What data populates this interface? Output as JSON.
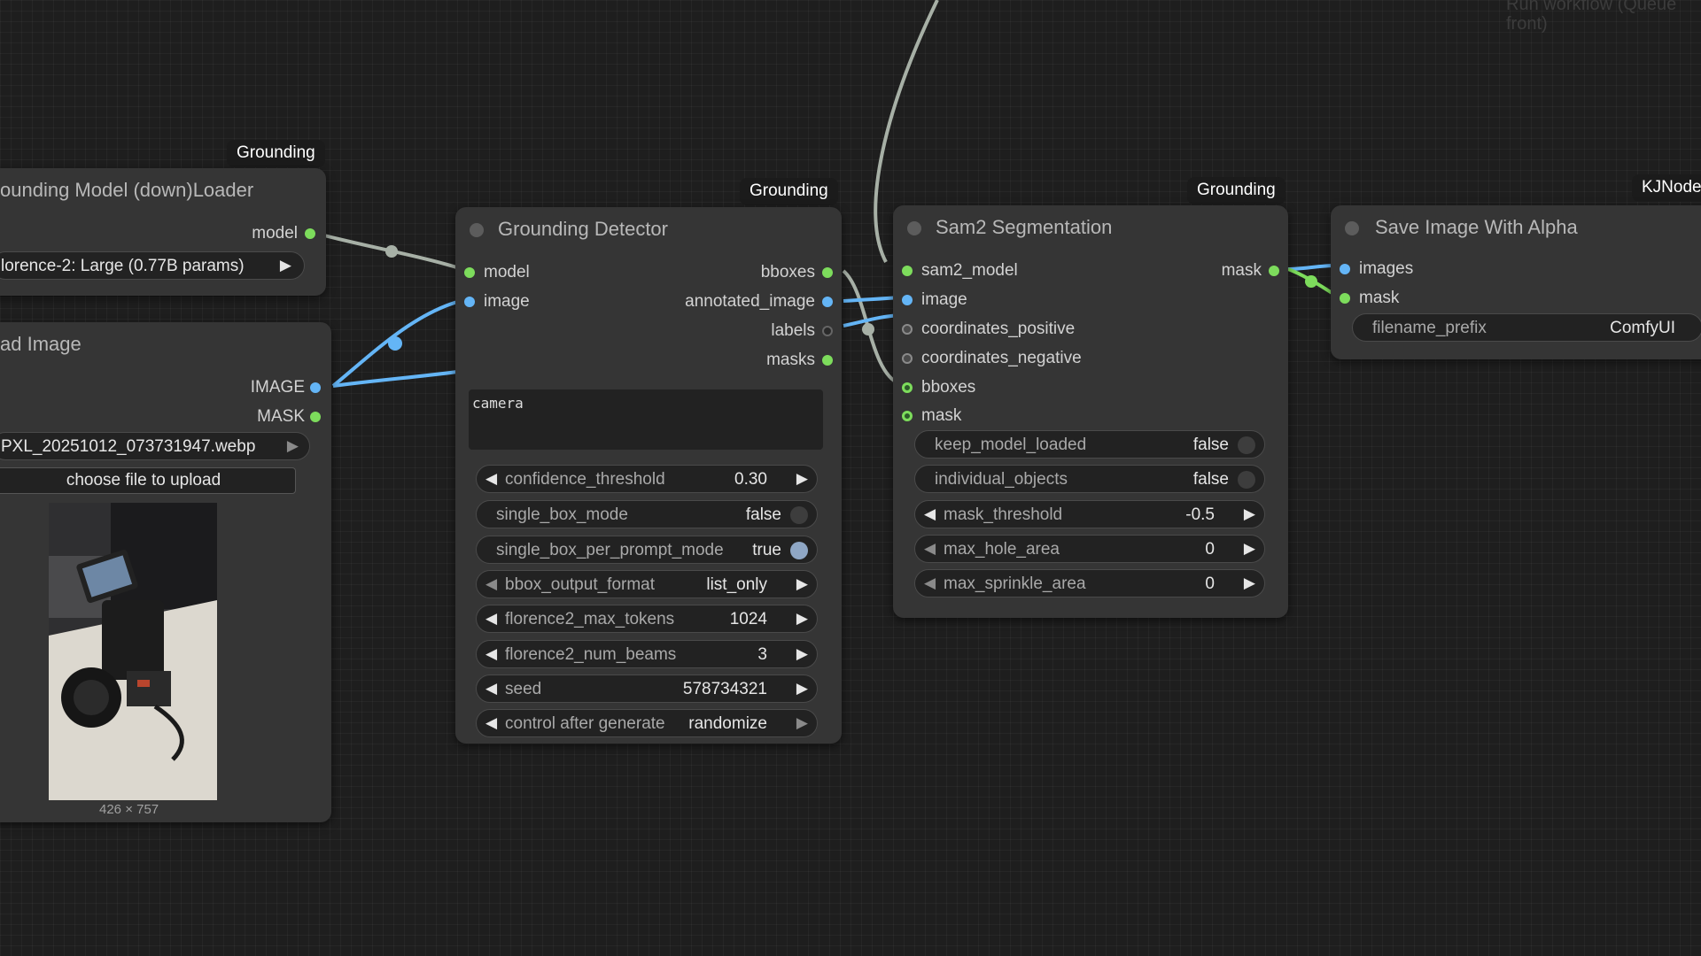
{
  "corner_hint": {
    "line1": "Run workflow (Queue",
    "line2": "front)"
  },
  "nodes": {
    "loader": {
      "badge": "Grounding",
      "title": "ounding Model (down)Loader",
      "output": "model",
      "model_value": "lorence-2: Large (0.77B params)"
    },
    "load_image": {
      "title": "ad Image",
      "outputs": [
        "IMAGE",
        "MASK"
      ],
      "file_value": "PXL_20251012_073731947.webp",
      "upload_label": "choose file to upload",
      "dimensions": "426 × 757"
    },
    "detector": {
      "badge": "Grounding",
      "title": "Grounding Detector",
      "inputs": [
        "model",
        "image"
      ],
      "outputs": [
        "bboxes",
        "annotated_image",
        "labels",
        "masks"
      ],
      "prompt": "camera",
      "widgets": {
        "confidence_threshold": {
          "label": "confidence_threshold",
          "value": "0.30"
        },
        "single_box_mode": {
          "label": "single_box_mode",
          "value": "false"
        },
        "single_box_per_prompt_mode": {
          "label": "single_box_per_prompt_mode",
          "value": "true"
        },
        "bbox_output_format": {
          "label": "bbox_output_format",
          "value": "list_only"
        },
        "florence2_max_tokens": {
          "label": "florence2_max_tokens",
          "value": "1024"
        },
        "florence2_num_beams": {
          "label": "florence2_num_beams",
          "value": "3"
        },
        "seed": {
          "label": "seed",
          "value": "578734321"
        },
        "control_after_generate": {
          "label": "control after generate",
          "value": "randomize"
        }
      }
    },
    "sam2": {
      "badge": "Grounding",
      "title": "Sam2 Segmentation",
      "inputs": [
        "sam2_model",
        "image",
        "coordinates_positive",
        "coordinates_negative",
        "bboxes",
        "mask"
      ],
      "output": "mask",
      "widgets": {
        "keep_model_loaded": {
          "label": "keep_model_loaded",
          "value": "false"
        },
        "individual_objects": {
          "label": "individual_objects",
          "value": "false"
        },
        "mask_threshold": {
          "label": "mask_threshold",
          "value": "-0.5"
        },
        "max_hole_area": {
          "label": "max_hole_area",
          "value": "0"
        },
        "max_sprinkle_area": {
          "label": "max_sprinkle_area",
          "value": "0"
        }
      }
    },
    "save": {
      "badge": "KJNode",
      "title": "Save Image With Alpha",
      "inputs": [
        "images",
        "mask"
      ],
      "filename_prefix": {
        "label": "filename_prefix",
        "value": "ComfyUI"
      }
    }
  },
  "colors": {
    "wire_image": "#64b5f6",
    "wire_other": "#a7b0a6",
    "slot_green": "#7ddc5c",
    "slot_blue": "#64b5f6",
    "node_bg": "#353535",
    "canvas_bg": "#1e1e1e"
  }
}
